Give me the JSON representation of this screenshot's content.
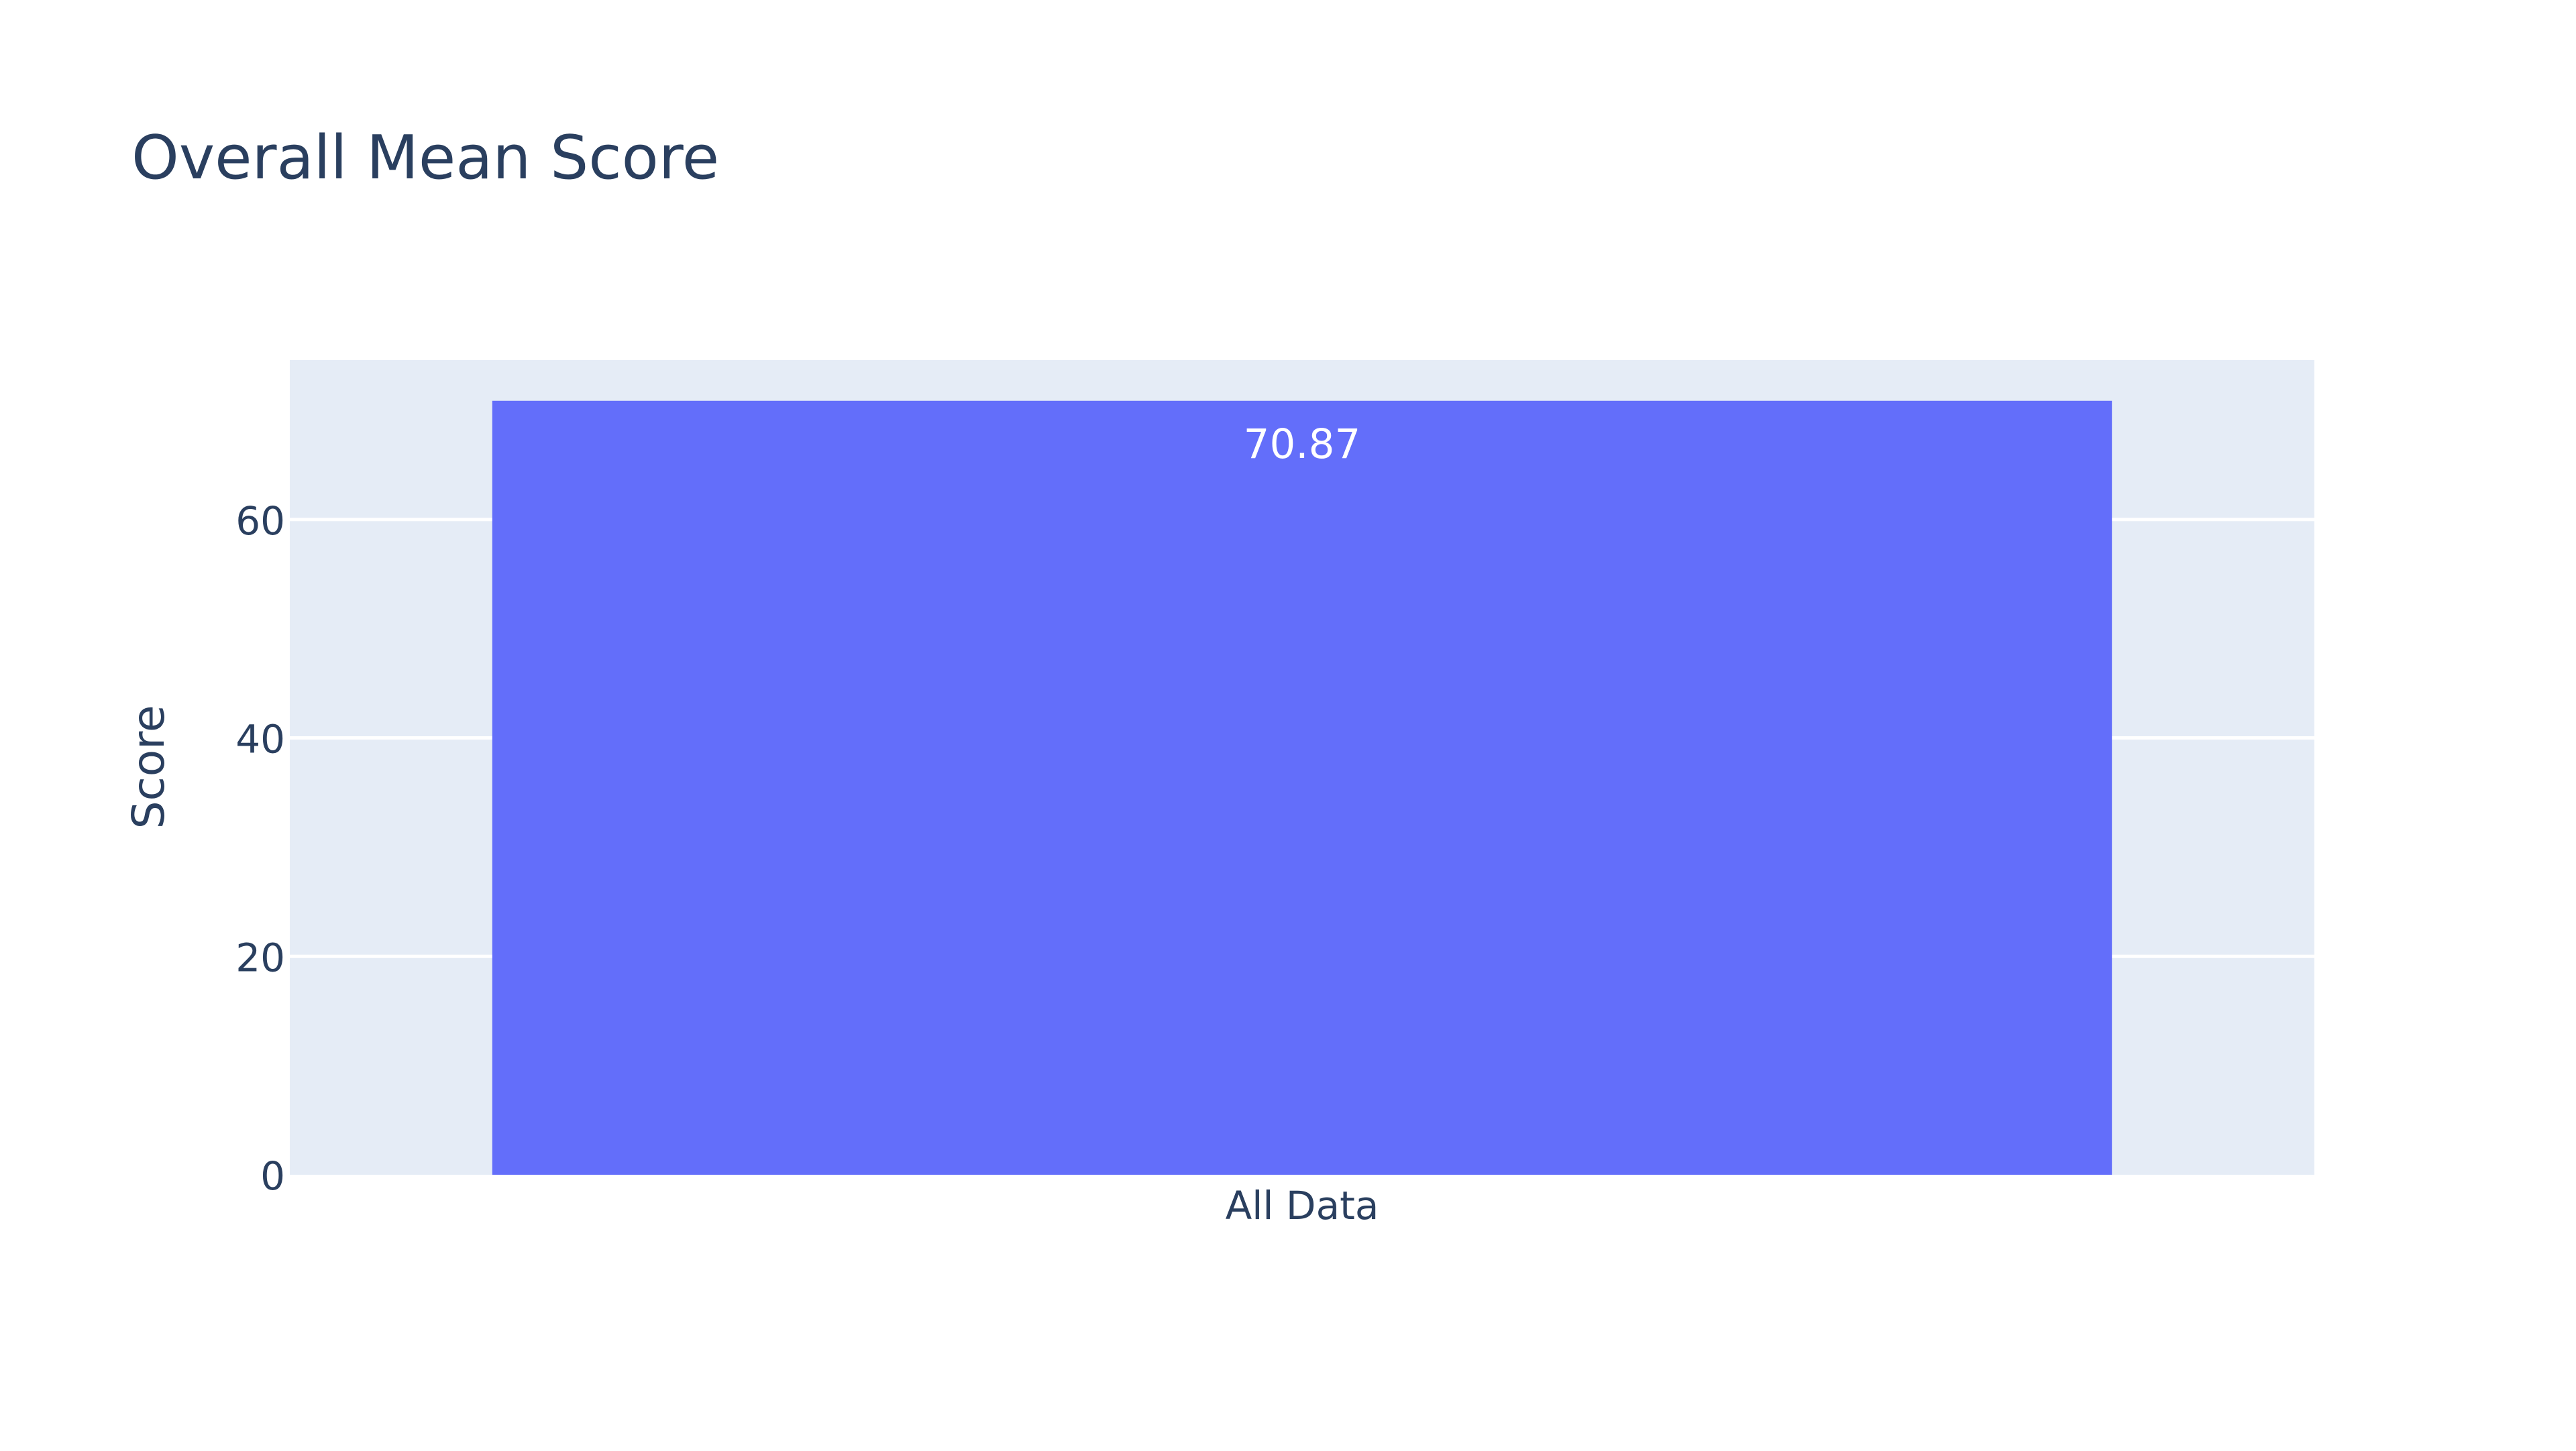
{
  "chart_data": {
    "type": "bar",
    "title": "Overall Mean Score",
    "xlabel": "",
    "ylabel": "Score",
    "categories": [
      "All Data"
    ],
    "values": [
      70.87
    ],
    "data_labels": [
      "70.87"
    ],
    "ylim": [
      0,
      74.6
    ],
    "yticks": [
      0,
      20,
      40,
      60
    ],
    "ytick_labels": [
      "0",
      "20",
      "40",
      "60"
    ],
    "grid": true,
    "legend": "none"
  },
  "colors": {
    "plot_background": "#E5ECF6",
    "gridline": "#FFFFFF",
    "bar": "#636EFA",
    "text": "#2A3F5F",
    "bar_label": "#FFFFFF"
  }
}
